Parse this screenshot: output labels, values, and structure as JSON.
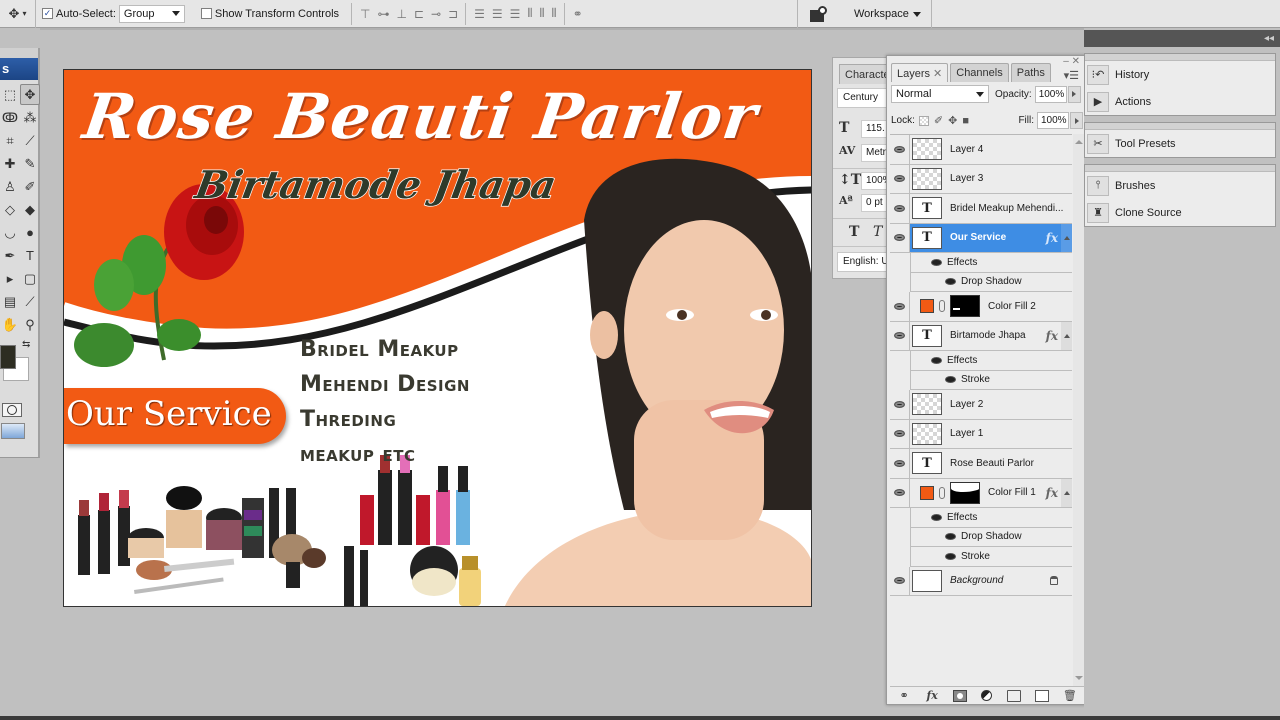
{
  "options_bar": {
    "tool_icon": "move-tool-icon",
    "auto_select_label": "Auto-Select:",
    "auto_select_checked": true,
    "auto_select_value": "Group",
    "show_transform_label": "Show Transform Controls",
    "show_transform_checked": false,
    "workspace_label": "Workspace"
  },
  "toolbox": {
    "title": "s",
    "tools": [
      {
        "name": "marquee-tool",
        "glyph": "⬚"
      },
      {
        "name": "move-tool",
        "glyph": "✥",
        "active": true
      },
      {
        "name": "lasso-tool",
        "glyph": "ↂ"
      },
      {
        "name": "magic-wand-tool",
        "glyph": "⁂"
      },
      {
        "name": "crop-tool",
        "glyph": "⌗"
      },
      {
        "name": "slice-tool",
        "glyph": "⟋"
      },
      {
        "name": "healing-brush-tool",
        "glyph": "✚"
      },
      {
        "name": "brush-tool",
        "glyph": "✎"
      },
      {
        "name": "clone-stamp-tool",
        "glyph": "♙"
      },
      {
        "name": "history-brush-tool",
        "glyph": "✐"
      },
      {
        "name": "eraser-tool",
        "glyph": "◇"
      },
      {
        "name": "paint-bucket-tool",
        "glyph": "◆"
      },
      {
        "name": "dodge-tool",
        "glyph": "◡"
      },
      {
        "name": "burn-tool",
        "glyph": "●"
      },
      {
        "name": "pen-tool",
        "glyph": "✒"
      },
      {
        "name": "type-tool",
        "glyph": "T"
      },
      {
        "name": "path-selection-tool",
        "glyph": "▸"
      },
      {
        "name": "rectangle-tool",
        "glyph": "▢"
      },
      {
        "name": "notes-tool",
        "glyph": "▤"
      },
      {
        "name": "eyedropper-tool",
        "glyph": "⟋"
      },
      {
        "name": "hand-tool",
        "glyph": "✋"
      },
      {
        "name": "zoom-tool",
        "glyph": "⚲"
      }
    ],
    "foreground_color": "#2d2d22",
    "background_color": "#ffffff"
  },
  "canvas": {
    "title": "Rose Beauti Parlor",
    "subtitle": "Birtamode Jhapa",
    "service_label": "Our Service",
    "services": [
      "Bridel Meakup",
      "Mehendi Design",
      "Threding",
      "meakup etc"
    ],
    "accent_color": "#f25a14"
  },
  "character_panel": {
    "tab": "Characte",
    "font": "Century",
    "size": "115.",
    "kerning": "Metr",
    "vertical_scale": "100%",
    "baseline_shift": "0 pt",
    "language": "English: U"
  },
  "layers_panel": {
    "tabs": [
      {
        "label": "Layers",
        "active": true,
        "closable": true
      },
      {
        "label": "Channels",
        "active": false
      },
      {
        "label": "Paths",
        "active": false
      }
    ],
    "blend_mode": "Normal",
    "opacity_label": "Opacity:",
    "opacity": "100%",
    "lock_label": "Lock:",
    "fill_label": "Fill:",
    "fill": "100%",
    "layers": [
      {
        "type": "layer",
        "kind": "pixel",
        "name": "Layer 4"
      },
      {
        "type": "layer",
        "kind": "pixel",
        "name": "Layer 3"
      },
      {
        "type": "layer",
        "kind": "text",
        "name": "Bridel Meakup Mehendi..."
      },
      {
        "type": "layer",
        "kind": "text",
        "name": "Our Service",
        "fx": true,
        "selected": true
      },
      {
        "type": "effects",
        "name": "Effects"
      },
      {
        "type": "effect",
        "name": "Drop Shadow"
      },
      {
        "type": "layer",
        "kind": "fill",
        "name": "Color Fill 2",
        "mask": "m1"
      },
      {
        "type": "layer",
        "kind": "text",
        "name": "Birtamode Jhapa",
        "fx": true
      },
      {
        "type": "effects",
        "name": "Effects"
      },
      {
        "type": "effect",
        "name": "Stroke"
      },
      {
        "type": "layer",
        "kind": "pixel",
        "name": "Layer 2"
      },
      {
        "type": "layer",
        "kind": "pixel",
        "name": "Layer 1"
      },
      {
        "type": "layer",
        "kind": "text",
        "name": "Rose Beauti Parlor"
      },
      {
        "type": "layer",
        "kind": "fill",
        "name": "Color Fill 1",
        "fx": true,
        "mask": "m2"
      },
      {
        "type": "effects",
        "name": "Effects"
      },
      {
        "type": "effect",
        "name": "Drop Shadow"
      },
      {
        "type": "effect",
        "name": "Stroke"
      },
      {
        "type": "layer",
        "kind": "background",
        "name": "Background",
        "locked": true
      }
    ],
    "fx_glyph": "fx",
    "bottom_buttons": [
      "link-layers",
      "add-layer-style",
      "add-mask",
      "new-adjustment-layer",
      "new-group",
      "new-layer",
      "delete-layer"
    ]
  },
  "dock": {
    "groups": [
      [
        {
          "label": "History",
          "icon": "history-icon",
          "glyph": "⁝↶"
        },
        {
          "label": "Actions",
          "icon": "actions-icon",
          "glyph": "▶"
        }
      ],
      [
        {
          "label": "Tool Presets",
          "icon": "tool-presets-icon",
          "glyph": "✂"
        }
      ],
      [
        {
          "label": "Brushes",
          "icon": "brushes-icon",
          "glyph": "⫯"
        },
        {
          "label": "Clone Source",
          "icon": "clone-source-icon",
          "glyph": "♜"
        }
      ]
    ]
  }
}
